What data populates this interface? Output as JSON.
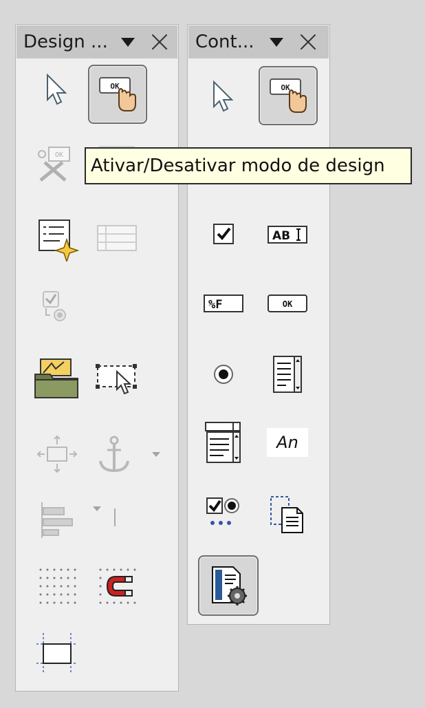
{
  "left_panel": {
    "title": "Design ...",
    "tools": [
      {
        "name": "select",
        "icon": "select-arrow-icon",
        "enabled": true
      },
      {
        "name": "design-mode",
        "icon": "design-mode-icon",
        "enabled": true,
        "pressed": true
      },
      {
        "name": "control-properties",
        "icon": "control-properties-icon",
        "enabled": false
      },
      {
        "name": "form-properties",
        "icon": "form-properties-icon",
        "enabled": true
      },
      {
        "name": "tab-order",
        "icon": "tab-order-icon",
        "enabled": false
      },
      {
        "name": "activation-order",
        "icon": "activation-order-icon",
        "enabled": false
      },
      {
        "name": "add-field",
        "icon": "add-field-icon",
        "enabled": false
      },
      {
        "name": "form-navigator",
        "icon": "form-navigator-icon",
        "enabled": true
      },
      {
        "name": "open-in-design-mode",
        "icon": "open-in-design-mode-icon",
        "enabled": true
      },
      {
        "name": "position-and-size",
        "icon": "position-size-icon",
        "enabled": false
      },
      {
        "name": "anchor",
        "icon": "anchor-icon",
        "enabled": false
      },
      {
        "name": "align",
        "icon": "align-icon",
        "enabled": false
      },
      {
        "name": "display-grid",
        "icon": "display-grid-icon",
        "enabled": true
      },
      {
        "name": "snap-to-grid",
        "icon": "snap-to-grid-icon",
        "enabled": true
      },
      {
        "name": "helplines-while-moving",
        "icon": "helplines-icon",
        "enabled": true
      }
    ]
  },
  "right_panel": {
    "title": "Cont...",
    "tools": [
      {
        "name": "select",
        "icon": "select-arrow-icon"
      },
      {
        "name": "design-mode",
        "icon": "design-mode-icon",
        "pressed": true
      },
      {
        "name": "check-box",
        "icon": "checkbox-icon"
      },
      {
        "name": "text-box",
        "icon": "text-box-icon",
        "text": "AB"
      },
      {
        "name": "formatted-field",
        "icon": "formatted-field-icon",
        "text": "%F"
      },
      {
        "name": "push-button",
        "icon": "push-button-icon",
        "text": "OK"
      },
      {
        "name": "option-button",
        "icon": "option-button-icon"
      },
      {
        "name": "list-box",
        "icon": "list-box-icon"
      },
      {
        "name": "combo-box",
        "icon": "combo-box-icon"
      },
      {
        "name": "label-field",
        "icon": "label-field-icon",
        "text": "An"
      },
      {
        "name": "more-controls",
        "icon": "more-controls-icon"
      },
      {
        "name": "form-design",
        "icon": "form-design-icon"
      },
      {
        "name": "wizards-on-off",
        "icon": "wizards-icon",
        "pressed": true
      }
    ]
  },
  "tooltip": {
    "text": "Ativar/Desativar modo de design"
  },
  "icon_labels": {
    "ok": "OK"
  },
  "colors": {
    "background": "#d8d8d8",
    "panel": "#efefef",
    "titlebar": "#c6c6c6",
    "tooltip_bg": "#ffffe1"
  }
}
